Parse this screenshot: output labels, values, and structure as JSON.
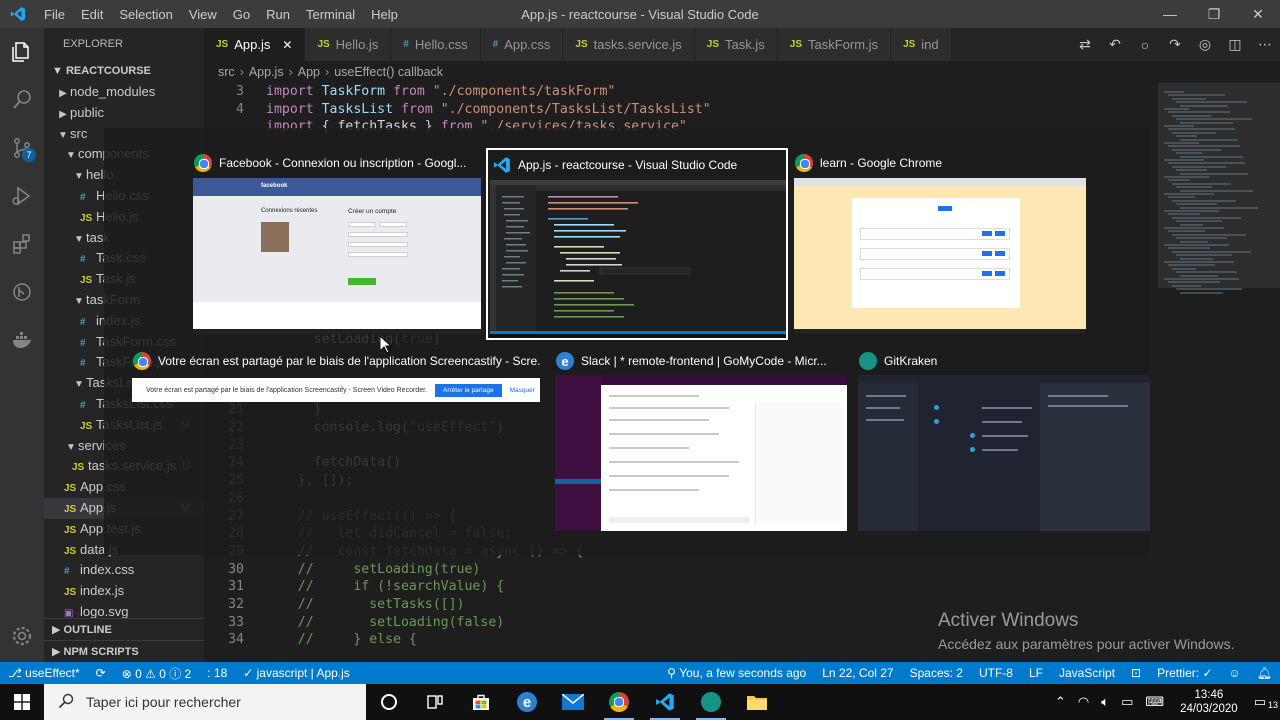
{
  "window": {
    "menu": [
      "File",
      "Edit",
      "Selection",
      "View",
      "Go",
      "Run",
      "Terminal",
      "Help"
    ],
    "title": "App.js - reactcourse - Visual Studio Code"
  },
  "activity": {
    "scm_badge": "7"
  },
  "sidebar": {
    "title": "EXPLORER",
    "root": "REACTCOURSE",
    "tree": [
      {
        "label": "node_modules",
        "kind": "folder",
        "open": false,
        "depth": 1
      },
      {
        "label": "public",
        "kind": "folder",
        "open": false,
        "depth": 1
      },
      {
        "label": "src",
        "kind": "folder",
        "open": true,
        "depth": 1
      },
      {
        "label": "components",
        "kind": "folder",
        "open": true,
        "depth": 2
      },
      {
        "label": "hello",
        "kind": "folder",
        "open": true,
        "depth": 3
      },
      {
        "label": "Hello.css",
        "kind": "css",
        "depth": 4
      },
      {
        "label": "Hello.js",
        "kind": "js",
        "depth": 4
      },
      {
        "label": "task",
        "kind": "folder",
        "open": true,
        "depth": 3
      },
      {
        "label": "Task.css",
        "kind": "css",
        "depth": 4
      },
      {
        "label": "Task.js",
        "kind": "js",
        "depth": 4
      },
      {
        "label": "taskForm",
        "kind": "folder",
        "open": true,
        "depth": 3
      },
      {
        "label": "index.js",
        "kind": "css",
        "depth": 4
      },
      {
        "label": "TaskForm.css",
        "kind": "css",
        "depth": 4
      },
      {
        "label": "TaskForm.js",
        "kind": "css",
        "depth": 4
      },
      {
        "label": "TasksList",
        "kind": "folder",
        "open": true,
        "depth": 3
      },
      {
        "label": "TasksList.css",
        "kind": "css",
        "depth": 4
      },
      {
        "label": "TasksList.js",
        "kind": "js",
        "depth": 4,
        "git": "M"
      },
      {
        "label": "services",
        "kind": "folder",
        "open": true,
        "depth": 2
      },
      {
        "label": "tasks.service.js",
        "kind": "js",
        "depth": 3,
        "git": "U"
      },
      {
        "label": "App.css",
        "kind": "js",
        "depth": 2
      },
      {
        "label": "App.js",
        "kind": "js",
        "depth": 2,
        "selected": true,
        "git": "M"
      },
      {
        "label": "App.test.js",
        "kind": "js",
        "depth": 2
      },
      {
        "label": "data.js",
        "kind": "js",
        "depth": 2
      },
      {
        "label": "index.css",
        "kind": "css",
        "depth": 2
      },
      {
        "label": "index.js",
        "kind": "js",
        "depth": 2
      },
      {
        "label": "logo.svg",
        "kind": "svg",
        "depth": 2
      }
    ],
    "outline": "OUTLINE",
    "npm": "NPM SCRIPTS"
  },
  "editor": {
    "tabs": [
      {
        "label": "App.js",
        "kind": "js",
        "active": true
      },
      {
        "label": "Hello.js",
        "kind": "js"
      },
      {
        "label": "Hello.css",
        "kind": "css"
      },
      {
        "label": "App.css",
        "kind": "css"
      },
      {
        "label": "tasks.service.js",
        "kind": "js"
      },
      {
        "label": "Task.js",
        "kind": "js"
      },
      {
        "label": "TaskForm.js",
        "kind": "js"
      },
      {
        "label": "ind",
        "kind": "js"
      }
    ],
    "breadcrumb": [
      "src",
      "App.js",
      "App",
      "useEffect() callback"
    ],
    "lines": [
      {
        "n": "3",
        "html": "<span class='kw'>import</span> <span class='id'>TaskForm</span> <span class='kw'>from</span> <span class='str'>\"./components/taskForm\"</span>"
      },
      {
        "n": "4",
        "html": "<span class='kw'>import</span> <span class='id'>TasksList</span> <span class='kw'>from</span> <span class='str'>\"./components/TasksList/TasksList\"</span>"
      },
      {
        "n": "",
        "html": "<span class='kw'>import</span> <span class='plain'>{ fetchTasks }</span> <span class='kw'>from</span> <span class='str'>\"./services/tasks.service\"</span>"
      },
      {
        "n": "",
        "html": ""
      },
      {
        "n": "",
        "html": ""
      },
      {
        "n": "",
        "html": ""
      },
      {
        "n": "",
        "html": ""
      },
      {
        "n": "",
        "html": ""
      },
      {
        "n": "",
        "html": ""
      },
      {
        "n": "",
        "html": ""
      },
      {
        "n": "",
        "html": ""
      },
      {
        "n": "",
        "html": ""
      },
      {
        "n": "",
        "html": ""
      },
      {
        "n": "",
        "html": ""
      },
      {
        "n": "",
        "html": "      <span class='fn'>setLoading</span><span class='plain'>(</span><span class='kw2'>true</span><span class='plain'>)</span>"
      },
      {
        "n": "",
        "html": ""
      },
      {
        "n": "",
        "html": ""
      },
      {
        "n": "",
        "html": "                                        <span class='plain'>.</span><span class='fn'>log</span><span class='plain'>(</span><span class='id'>message</span><span class='plain'>)</span>"
      },
      {
        "n": "21",
        "html": "      <span class='plain'>}</span>"
      },
      {
        "n": "22",
        "html": "      <span class='id'>console</span><span class='plain'>.</span><span class='fn'>log</span><span class='plain'>(</span><span class='str'>\"useEffect\"</span><span class='plain'>)</span>"
      },
      {
        "n": "23",
        "html": ""
      },
      {
        "n": "24",
        "html": "      <span class='fn'>fetchData</span><span class='plain'>()</span>"
      },
      {
        "n": "25",
        "html": "    <span class='plain'>}, []);</span>"
      },
      {
        "n": "26",
        "html": ""
      },
      {
        "n": "27",
        "html": "    <span class='cm'>// useEffect(() =&gt; {</span>"
      },
      {
        "n": "28",
        "html": "    <span class='cm'>//   let didCancel = false;</span>"
      },
      {
        "n": "29",
        "html": "    <span class='cm'>//   const fetchData = async () =&gt; {</span>"
      },
      {
        "n": "30",
        "html": "    <span class='cm'>//     setLoading(true)</span>"
      },
      {
        "n": "31",
        "html": "    <span class='cm'>//     if (!searchValue) {</span>"
      },
      {
        "n": "32",
        "html": "    <span class='cm'>//       setTasks([])</span>"
      },
      {
        "n": "33",
        "html": "    <span class='cm'>//       setLoading(false)</span>"
      },
      {
        "n": "34",
        "html": "    <span class='cm'>//     } else {</span>"
      }
    ]
  },
  "watermark": {
    "title": "Activer Windows",
    "subtitle": "Accédez aux paramètres pour activer Windows."
  },
  "alttab": {
    "windows": [
      {
        "title": "Facebook - Connexion ou inscription - Googl...",
        "app": "chrome"
      },
      {
        "title": "App.js - reactcourse - Visual Studio Code",
        "app": "vscode",
        "selected": true
      },
      {
        "title": "learn - Google Chrome",
        "app": "chrome"
      },
      {
        "title": "Votre écran est partagé par le biais de l'application Screencastify - Scre...",
        "app": "chrome"
      },
      {
        "title": "Slack | * remote-frontend | GoMyCode - Micr...",
        "app": "edge"
      },
      {
        "title": "GitKraken",
        "app": "gitkraken"
      }
    ],
    "fb": {
      "brand": "facebook",
      "recent": "Connexions récentes",
      "create": "Créer un compte"
    },
    "screencastify": {
      "text": "Votre écran est partagé par le biais de l'application Screencastify - Screen Video Recorder.",
      "stop": "Arrêter le partage",
      "hide": "Masquer"
    }
  },
  "status": {
    "branch": "useEffect*",
    "problems": "⊗ 0 ⚠ 0 ⓘ 2",
    "ln_info": ": 18",
    "lang_check": "javascript | App.js",
    "blame": "You, a few seconds ago",
    "cursor": "Ln 22, Col 27",
    "spaces": "Spaces: 2",
    "encoding": "UTF-8",
    "eol": "LF",
    "language": "JavaScript",
    "prettier": "Prettier: ✓"
  },
  "taskbar": {
    "search_placeholder": "Taper ici pour rechercher",
    "time": "13:46",
    "date": "24/03/2020",
    "notif": "13"
  },
  "colors": {
    "accent": "#007acc",
    "editor_bg": "#1e1e1e"
  }
}
